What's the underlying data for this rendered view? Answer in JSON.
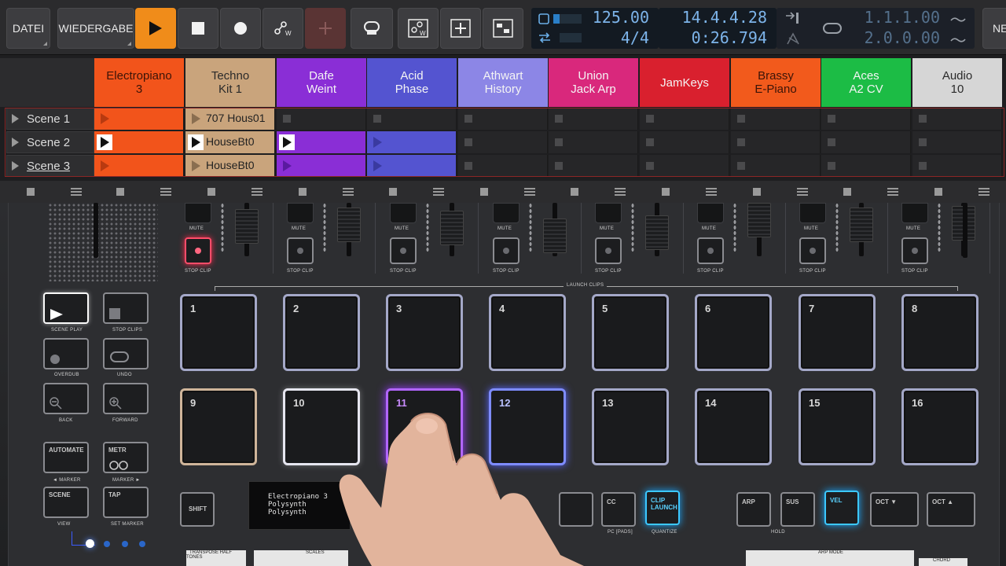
{
  "toolbar": {
    "file_label": "DATEI",
    "playback_label": "WIEDERGABE",
    "next_label": "NE",
    "tempo": "125.00",
    "time_signature": "4/4",
    "position_bars": "14.4.4.28",
    "position_time": "0:26.794",
    "loop_start": "1.1.1.00",
    "loop_end": "2.0.0.00"
  },
  "tracks": [
    {
      "name": "Electropiano\n3",
      "color": "#f2541b"
    },
    {
      "name": "Techno\nKit 1",
      "color": "#c9a47c"
    },
    {
      "name": "Dafe\nWeint",
      "color": "#8a2ed6"
    },
    {
      "name": "Acid\nPhase",
      "color": "#5454d0"
    },
    {
      "name": "Athwart\nHistory",
      "color": "#8c86e6"
    },
    {
      "name": "Union\nJack Arp",
      "color": "#d9287c"
    },
    {
      "name": "JamKeys",
      "color": "#d9202e"
    },
    {
      "name": "Brassy\nE-Piano",
      "color": "#f25a1c"
    },
    {
      "name": "Aces\nA2 CV",
      "color": "#1cbc45"
    },
    {
      "name": "Audio\n10",
      "color": "#d6d6d6"
    }
  ],
  "scenes": [
    {
      "label": "Scene 1",
      "clip_text": "707 Hous01"
    },
    {
      "label": "Scene 2",
      "clip_text": "HouseBt0"
    },
    {
      "label": "Scene 3",
      "clip_text": "HouseBt0"
    }
  ],
  "controller": {
    "labels": {
      "mute": "MUTE",
      "stop_clip": "STOP CLIP",
      "launch_clips": "LAUNCH CLIPS",
      "scene_play": "SCENE PLAY",
      "stop_clips": "STOP CLIPS",
      "overdub": "OVERDUB",
      "undo": "UNDO",
      "back": "BACK",
      "forward": "FORWARD",
      "automate": "AUTOMATE",
      "metr": "METR",
      "marker_prev": "◄ MARKER",
      "marker_next": "MARKER ►",
      "scene": "SCENE",
      "tap": "TAP",
      "view": "VIEW",
      "set_marker": "SET MARKER",
      "shift": "SHIFT",
      "cc": "CC",
      "pc_pads": "PC [PADS]",
      "clip_launch": "CLIP LAUNCH",
      "quantize": "QUANTIZE",
      "arp": "ARP",
      "sus": "SUS",
      "vel": "VEL",
      "oct_down": "OCT ▼",
      "oct_up": "OCT ▲",
      "hold": "HOLD",
      "transpose": "TRANSPOSE HALF TONES",
      "scales": "SCALES",
      "arp_mode": "ARP MODE",
      "chord": "CHORD"
    },
    "pads": [
      "1",
      "2",
      "3",
      "4",
      "5",
      "6",
      "7",
      "8",
      "9",
      "10",
      "11",
      "12",
      "13",
      "14",
      "15",
      "16"
    ],
    "oled": [
      "Electropiano 3",
      "Polysynth",
      "Polysynth"
    ]
  }
}
